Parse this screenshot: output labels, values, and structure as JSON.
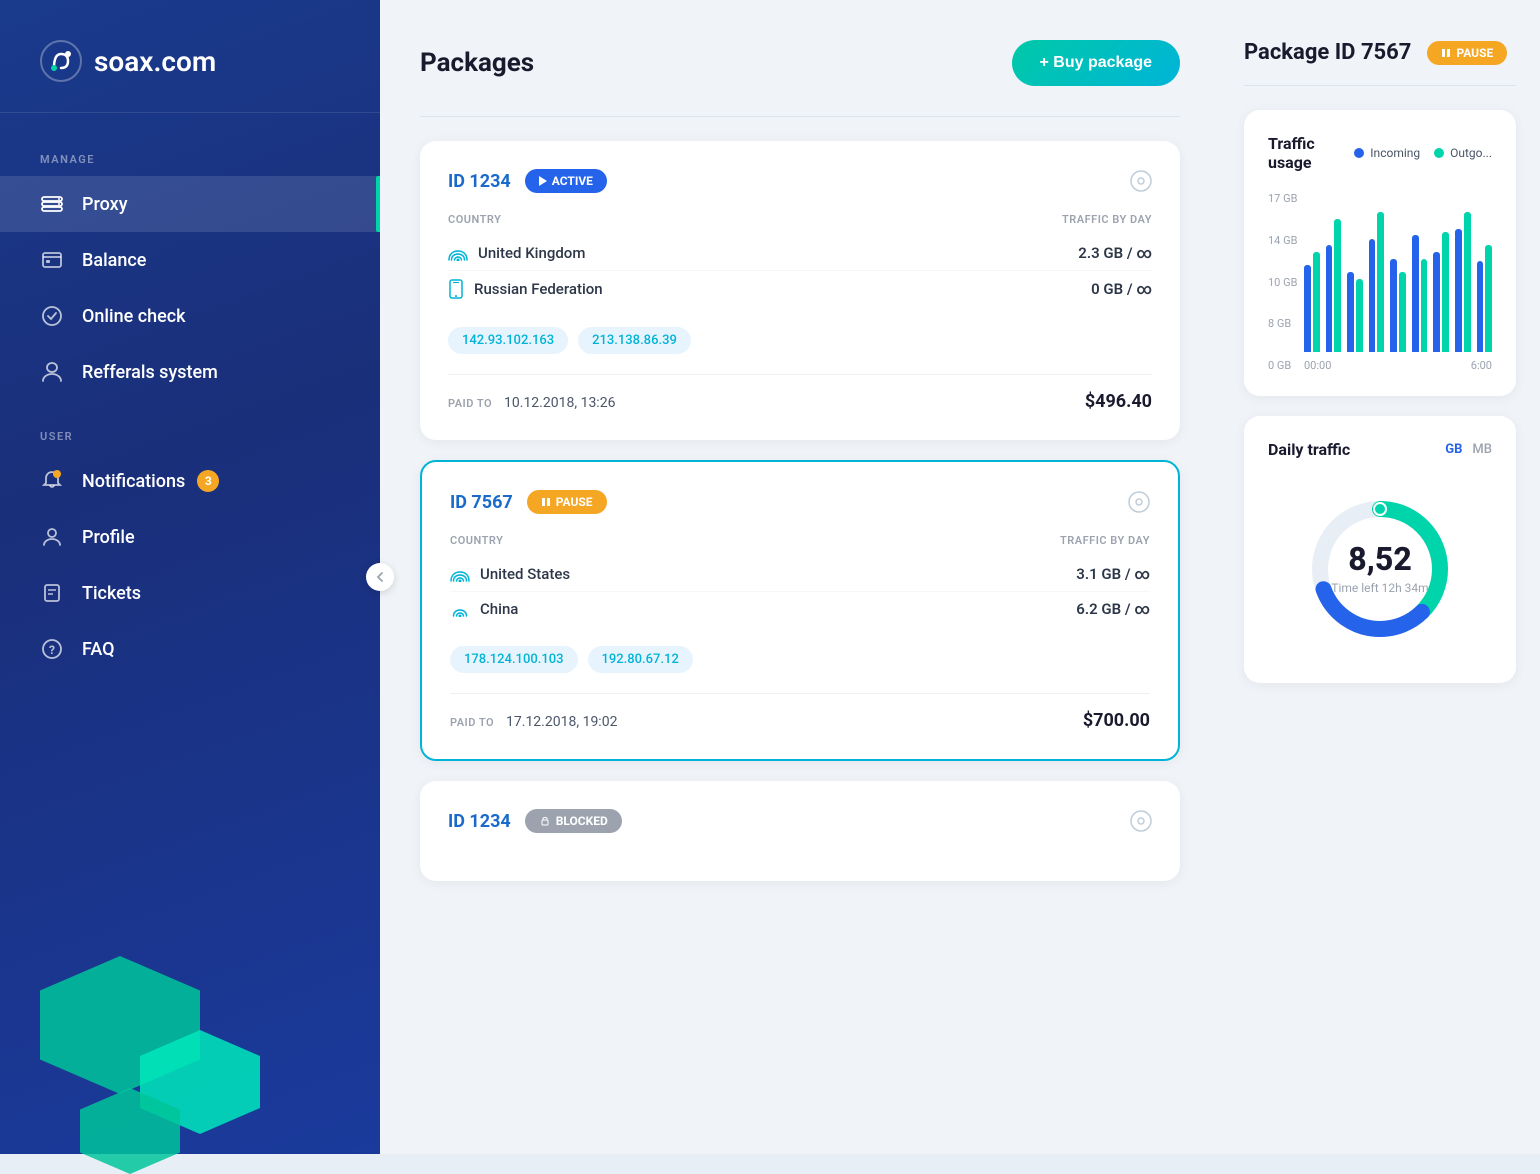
{
  "app": {
    "logo_text": "soax.com",
    "logo_icon": "🔗"
  },
  "sidebar": {
    "manage_label": "MANAGE",
    "user_label": "USER",
    "items_manage": [
      {
        "id": "proxy",
        "label": "Proxy",
        "active": true
      },
      {
        "id": "balance",
        "label": "Balance",
        "active": false
      },
      {
        "id": "online-check",
        "label": "Online check",
        "active": false
      },
      {
        "id": "referrals",
        "label": "Refferals system",
        "active": false
      }
    ],
    "items_user": [
      {
        "id": "notifications",
        "label": "Notifications",
        "badge": "3",
        "active": false
      },
      {
        "id": "profile",
        "label": "Profile",
        "active": false
      },
      {
        "id": "tickets",
        "label": "Tickets",
        "active": false
      },
      {
        "id": "faq",
        "label": "FAQ",
        "active": false
      }
    ]
  },
  "packages": {
    "title": "Packages",
    "buy_btn": "+ Buy package",
    "cards": [
      {
        "id": "ID 1234",
        "status": "ACTIVE",
        "status_type": "active",
        "country_label": "COUNTRY",
        "traffic_label": "TRAFFIC BY DAY",
        "countries": [
          {
            "name": "United Kingdom",
            "traffic": "2.3 GB / ∞",
            "icon": "wifi"
          },
          {
            "name": "Russian Federation",
            "traffic": "0 GB / ∞",
            "icon": "mobile"
          }
        ],
        "ips": [
          "142.93.102.163",
          "213.138.86.39"
        ],
        "paid_to_label": "PAID TO",
        "paid_to_date": "10.12.2018, 13:26",
        "price": "$496.40",
        "highlighted": false
      },
      {
        "id": "ID 7567",
        "status": "PAUSE",
        "status_type": "pause",
        "country_label": "COUNTRY",
        "traffic_label": "TRAFFIC BY DAY",
        "countries": [
          {
            "name": "United States",
            "traffic": "3.1 GB / ∞",
            "icon": "wifi"
          },
          {
            "name": "China",
            "traffic": "6.2 GB / ∞",
            "icon": "wifi-small"
          }
        ],
        "ips": [
          "178.124.100.103",
          "192.80.67.12"
        ],
        "paid_to_label": "PAID TO",
        "paid_to_date": "17.12.2018, 19:02",
        "price": "$700.00",
        "highlighted": true
      },
      {
        "id": "ID 1234",
        "status": "BLOCKED",
        "status_type": "blocked",
        "highlighted": false,
        "partial": true
      }
    ]
  },
  "right_panel": {
    "package_title": "Package ID 7567",
    "pause_label": "PAUSE",
    "traffic_usage": {
      "title": "Traffic usage",
      "incoming_label": "Incoming",
      "outgoing_label": "Outgo...",
      "y_labels": [
        "17 GB",
        "14 GB",
        "10 GB",
        "8 GB",
        "0 GB"
      ],
      "x_labels": [
        "00:00",
        "6:00"
      ],
      "bars": [
        {
          "incoming": 65,
          "outgoing": 75
        },
        {
          "incoming": 80,
          "outgoing": 100
        },
        {
          "incoming": 60,
          "outgoing": 55
        },
        {
          "incoming": 85,
          "outgoing": 105
        },
        {
          "incoming": 70,
          "outgoing": 60
        },
        {
          "incoming": 88,
          "outgoing": 70
        },
        {
          "incoming": 75,
          "outgoing": 90
        },
        {
          "incoming": 92,
          "outgoing": 105
        },
        {
          "incoming": 68,
          "outgoing": 80
        }
      ]
    },
    "daily_traffic": {
      "title": "Daily traffic",
      "unit_gb": "GB",
      "unit_mb": "MB",
      "value": "8,52",
      "time_left": "Time left 12h 34m",
      "donut_used_pct": 62
    }
  }
}
